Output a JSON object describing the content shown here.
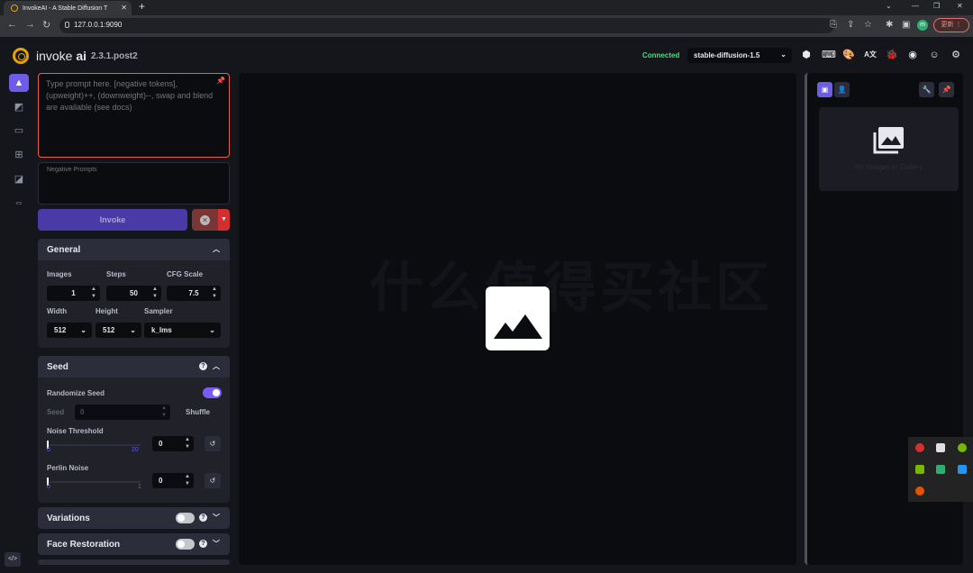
{
  "browser": {
    "tab_title": "InvokeAI - A Stable Diffusion T",
    "url": "127.0.0.1:9090",
    "profile_initial": "m",
    "update_label": "更新 ⋮",
    "new_tab": "+"
  },
  "header": {
    "brand_main": "invoke ",
    "brand_bold": "ai",
    "version": "2.3.1.post2",
    "status": "Connected",
    "model": "stable-diffusion-1.5",
    "status_color": "#4ade80"
  },
  "prompt": {
    "placeholder": "Type prompt here. [negative tokens], (upweight)++, (downweight)--, swap and blend are available (see docs)",
    "negative_placeholder": "Negative Prompts"
  },
  "actions": {
    "invoke": "Invoke"
  },
  "general": {
    "title": "General",
    "images_label": "Images",
    "images_value": "1",
    "steps_label": "Steps",
    "steps_value": "50",
    "cfg_label": "CFG Scale",
    "cfg_value": "7.5",
    "width_label": "Width",
    "width_value": "512",
    "height_label": "Height",
    "height_value": "512",
    "sampler_label": "Sampler",
    "sampler_value": "k_lms"
  },
  "seed": {
    "title": "Seed",
    "randomize_label": "Randomize Seed",
    "randomize_on": true,
    "seed_label": "Seed",
    "seed_value": "0",
    "shuffle": "Shuffle",
    "noise_label": "Noise Threshold",
    "noise_min": "0",
    "noise_max": "20",
    "noise_value": "0",
    "perlin_label": "Perlin Noise",
    "perlin_min": "0",
    "perlin_max": "1",
    "perlin_value": "0"
  },
  "variations": {
    "title": "Variations",
    "enabled": false
  },
  "face_restoration": {
    "title": "Face Restoration",
    "enabled": false
  },
  "gallery": {
    "empty_text": "No Images In Gallery"
  },
  "canvas": {
    "watermark": "什么值得买社区"
  },
  "colors": {
    "accent": "#6c5ce7",
    "prompt_border": "#e9604c",
    "logo": "#e8a300"
  }
}
